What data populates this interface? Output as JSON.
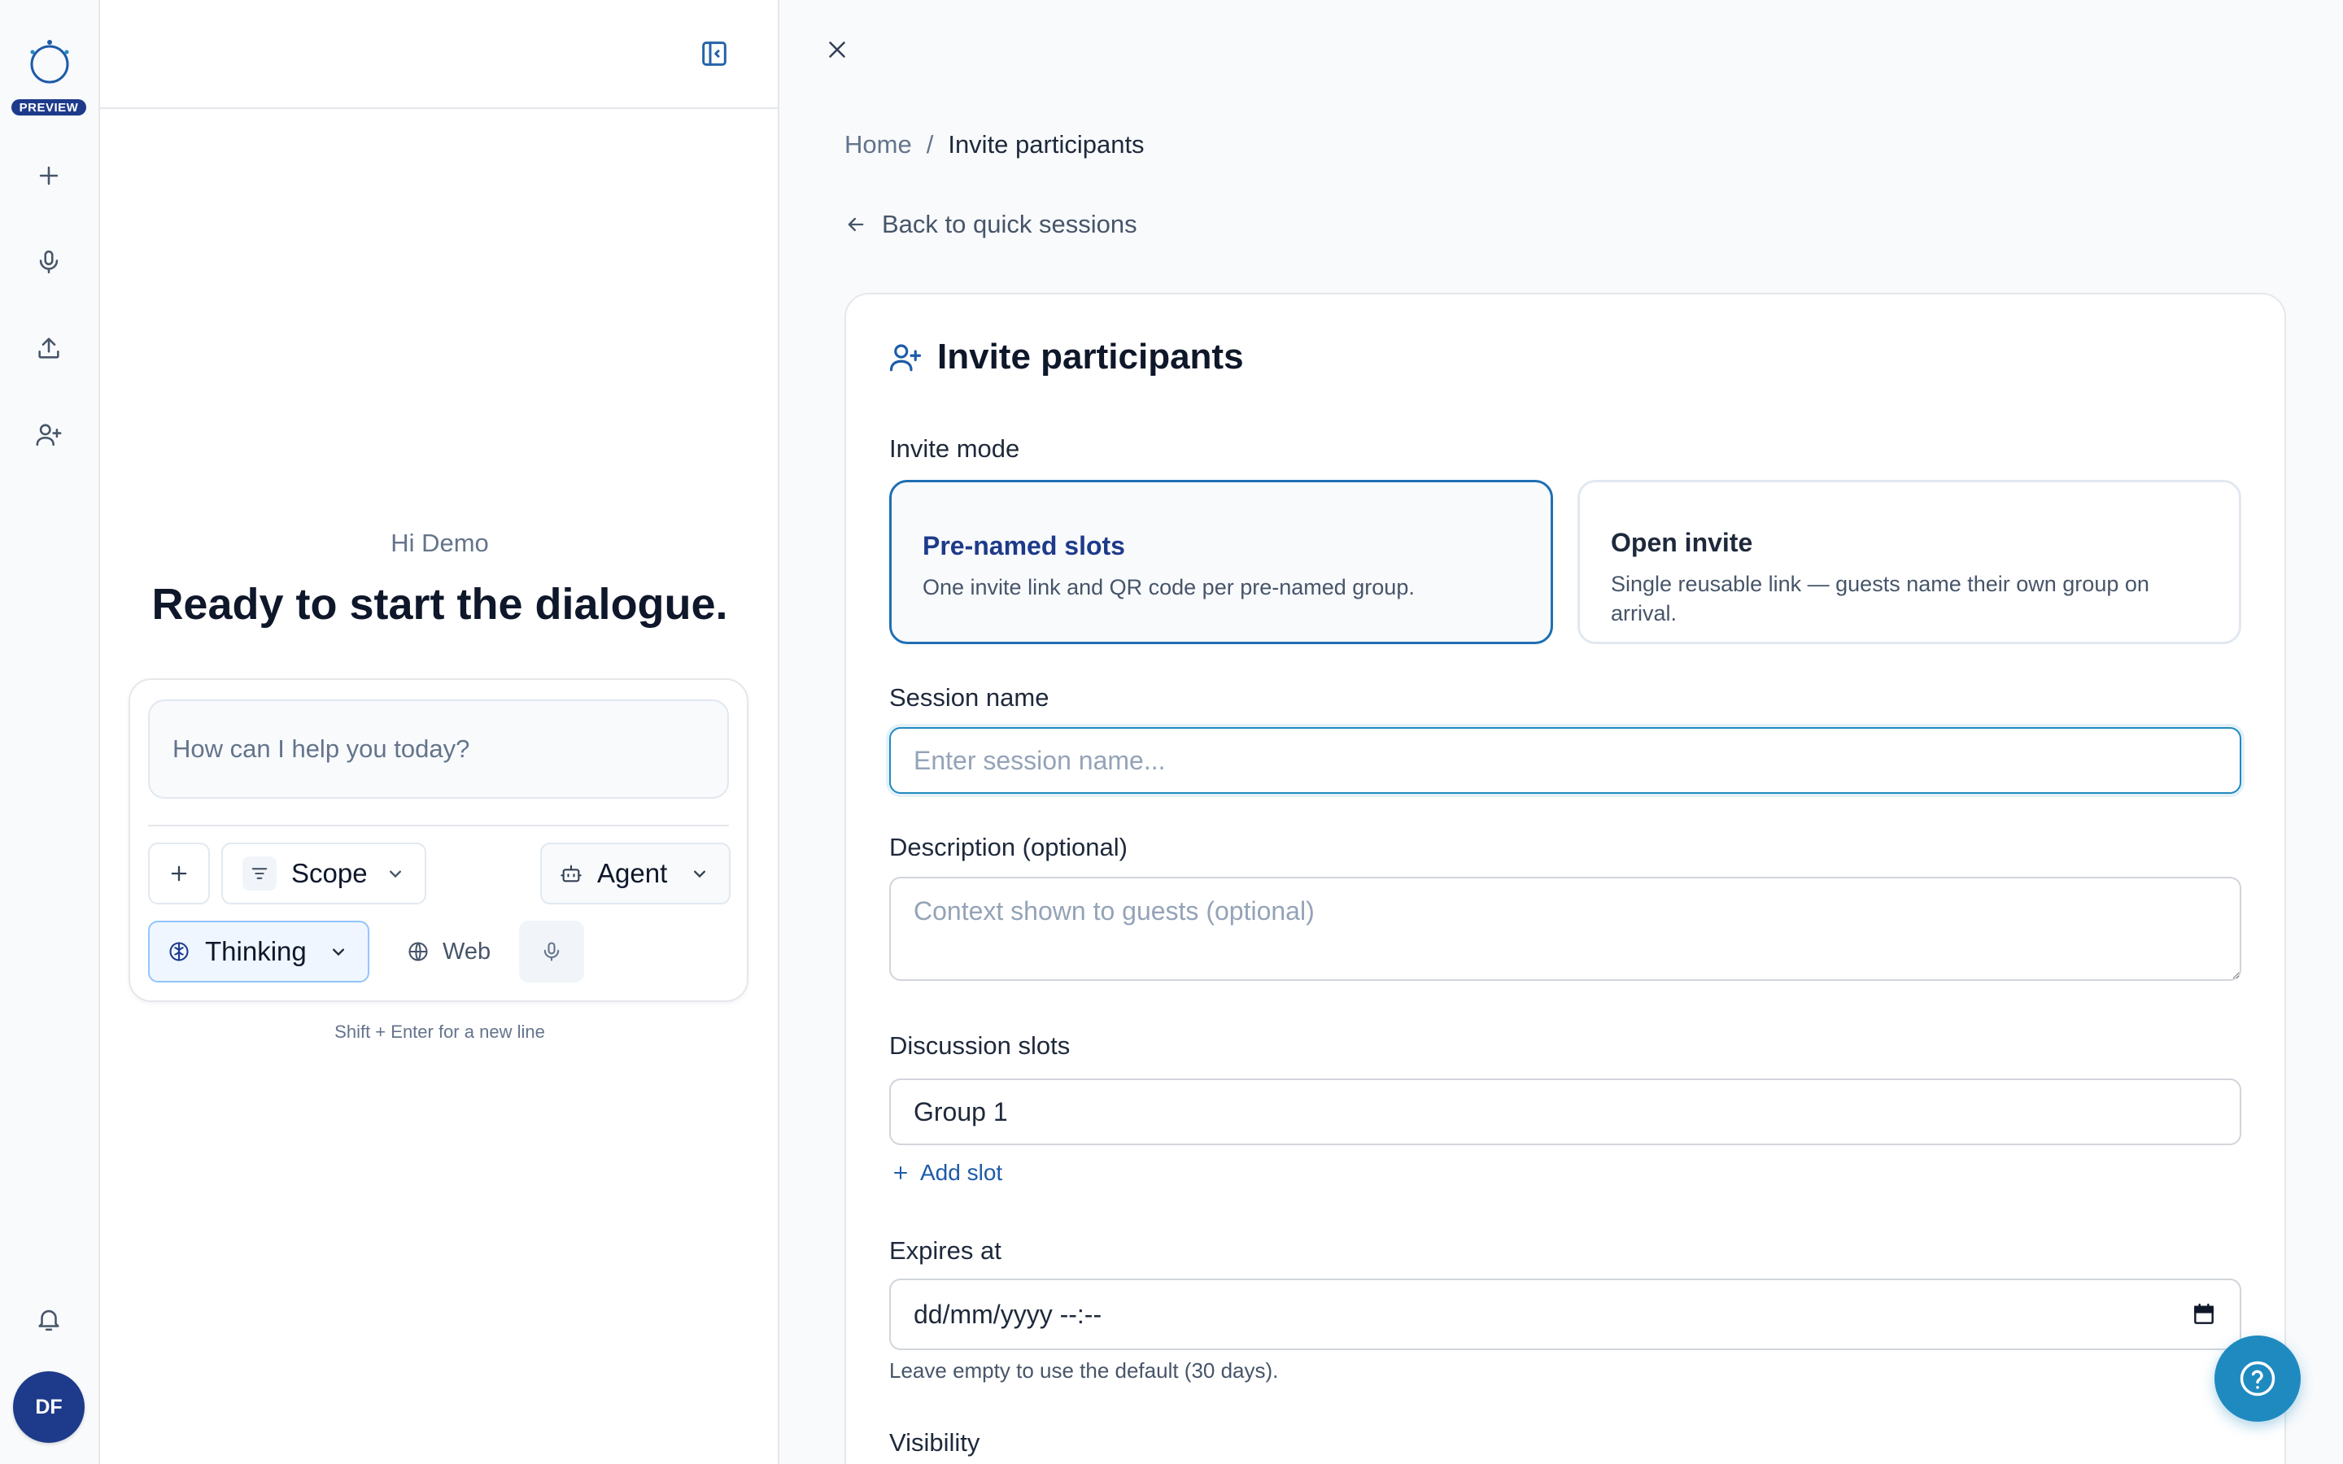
{
  "rail": {
    "badge": "PREVIEW",
    "avatar_initials": "DF",
    "icons": [
      "logo-icon",
      "plus-icon",
      "microphone-icon",
      "upload-icon",
      "user-plus-icon",
      "bell-icon"
    ]
  },
  "chat": {
    "greeting": "Hi Demo",
    "headline": "Ready to start the dialogue.",
    "input_placeholder": "How can I help you today?",
    "scope_label": "Scope",
    "agent_label": "Agent",
    "thinking_label": "Thinking",
    "web_label": "Web",
    "hint": "Shift + Enter for a new line"
  },
  "breadcrumb": {
    "home": "Home",
    "separator": "/",
    "current": "Invite participants"
  },
  "back_link": "Back to quick sessions",
  "form": {
    "title": "Invite participants",
    "invite_mode_label": "Invite mode",
    "modes": [
      {
        "title": "Pre-named slots",
        "desc": "One invite link and QR code per pre-named group.",
        "selected": true
      },
      {
        "title": "Open invite",
        "desc": "Single reusable link — guests name their own group on arrival.",
        "selected": false
      }
    ],
    "session_name_label": "Session name",
    "session_name_placeholder": "Enter session name...",
    "description_label": "Description (optional)",
    "description_placeholder": "Context shown to guests (optional)",
    "slots_label": "Discussion slots",
    "slot_value": "Group 1",
    "add_slot": "Add slot",
    "expires_label": "Expires at",
    "expires_placeholder": "dd/mm/yyyy --:--",
    "expires_note": "Leave empty to use the default (30 days).",
    "visibility_label": "Visibility"
  },
  "colors": {
    "accent": "#1f8ac0",
    "brand": "#1e3a8a",
    "selected_border": "#1f6fb2"
  }
}
